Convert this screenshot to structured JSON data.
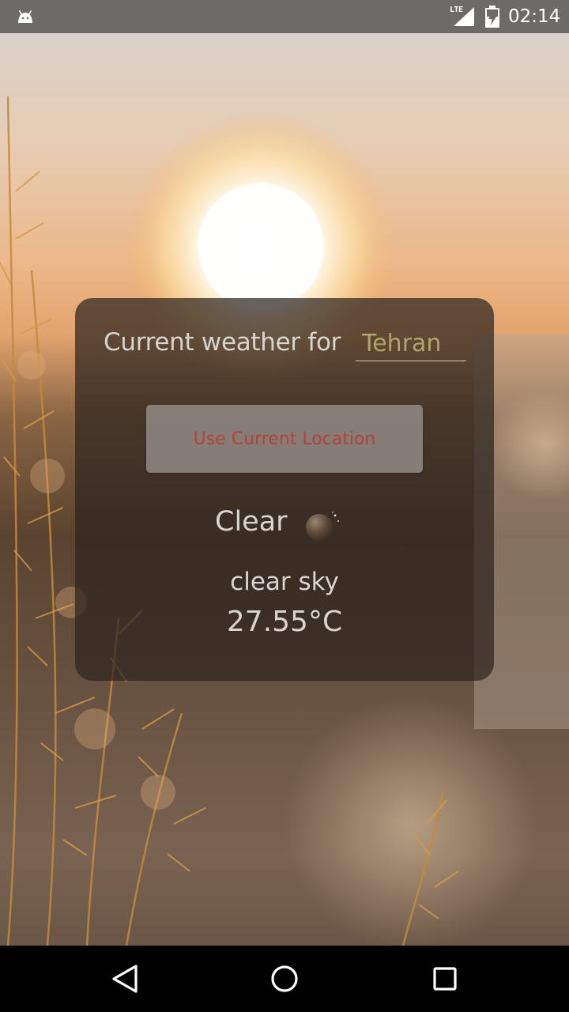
{
  "status_bar": {
    "network_label": "LTE",
    "time": "02:14",
    "icons": [
      "android-debug-icon",
      "signal-icon",
      "battery-charging-icon"
    ]
  },
  "weather": {
    "header_label": "Current weather for",
    "city_value": "Tehran",
    "location_button_label": "Use Current Location",
    "condition": "Clear",
    "condition_icon": "clear-night-icon",
    "description": "clear sky",
    "temperature": "27.55°C"
  },
  "nav_bar": {
    "icons": [
      "back-icon",
      "home-icon",
      "recents-icon"
    ]
  },
  "colors": {
    "status_bar": "#6d6b69",
    "card_background": "#2c241e",
    "button_text": "#b4423f",
    "city_text": "#b0a468",
    "label_text": "#d9d4cf"
  }
}
